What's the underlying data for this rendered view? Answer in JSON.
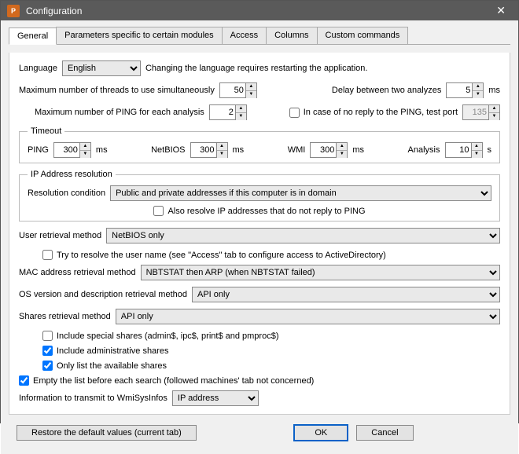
{
  "window": {
    "title": "Configuration"
  },
  "tabs": {
    "general": "General",
    "params": "Parameters specific to certain modules",
    "access": "Access",
    "columns": "Columns",
    "custom": "Custom commands"
  },
  "language": {
    "label": "Language",
    "value": "English",
    "note": "Changing the language requires restarting the application."
  },
  "threads": {
    "label": "Maximum number of threads to use simultaneously",
    "value": "50"
  },
  "delay": {
    "label": "Delay between two analyzes",
    "value": "5",
    "unit": "ms"
  },
  "pingEach": {
    "label": "Maximum number of PING for each analysis",
    "value": "2"
  },
  "noReply": {
    "label": "In case of no reply to the PING, test port",
    "value": "135"
  },
  "timeout": {
    "legend": "Timeout",
    "ping": {
      "label": "PING",
      "value": "300",
      "unit": "ms"
    },
    "netbios": {
      "label": "NetBIOS",
      "value": "300",
      "unit": "ms"
    },
    "wmi": {
      "label": "WMI",
      "value": "300",
      "unit": "ms"
    },
    "analysis": {
      "label": "Analysis",
      "value": "10",
      "unit": "s"
    }
  },
  "ipres": {
    "legend": "IP Address resolution",
    "condLabel": "Resolution condition",
    "condValue": "Public and private addresses if this computer is in domain",
    "alsoResolve": "Also resolve IP addresses that do not reply to PING"
  },
  "userRetrieval": {
    "label": "User retrieval method",
    "value": "NetBIOS only",
    "tryResolve": "Try to resolve the user name (see \"Access\" tab to configure access to ActiveDirectory)"
  },
  "mac": {
    "label": "MAC address retrieval method",
    "value": "NBTSTAT then ARP (when NBTSTAT failed)"
  },
  "osver": {
    "label": "OS version and description retrieval method",
    "value": "API only"
  },
  "shares": {
    "label": "Shares retrieval method",
    "value": "API only",
    "special": "Include special shares (admin$, ipc$, print$ and pmproc$)",
    "admin": "Include administrative shares",
    "only": "Only list the available shares"
  },
  "emptyList": "Empty the list before each search (followed machines' tab not concerned)",
  "wmiInfo": {
    "label": "Information to transmit to WmiSysInfos",
    "value": "IP address"
  },
  "buttons": {
    "restore": "Restore the default values (current tab)",
    "ok": "OK",
    "cancel": "Cancel"
  }
}
